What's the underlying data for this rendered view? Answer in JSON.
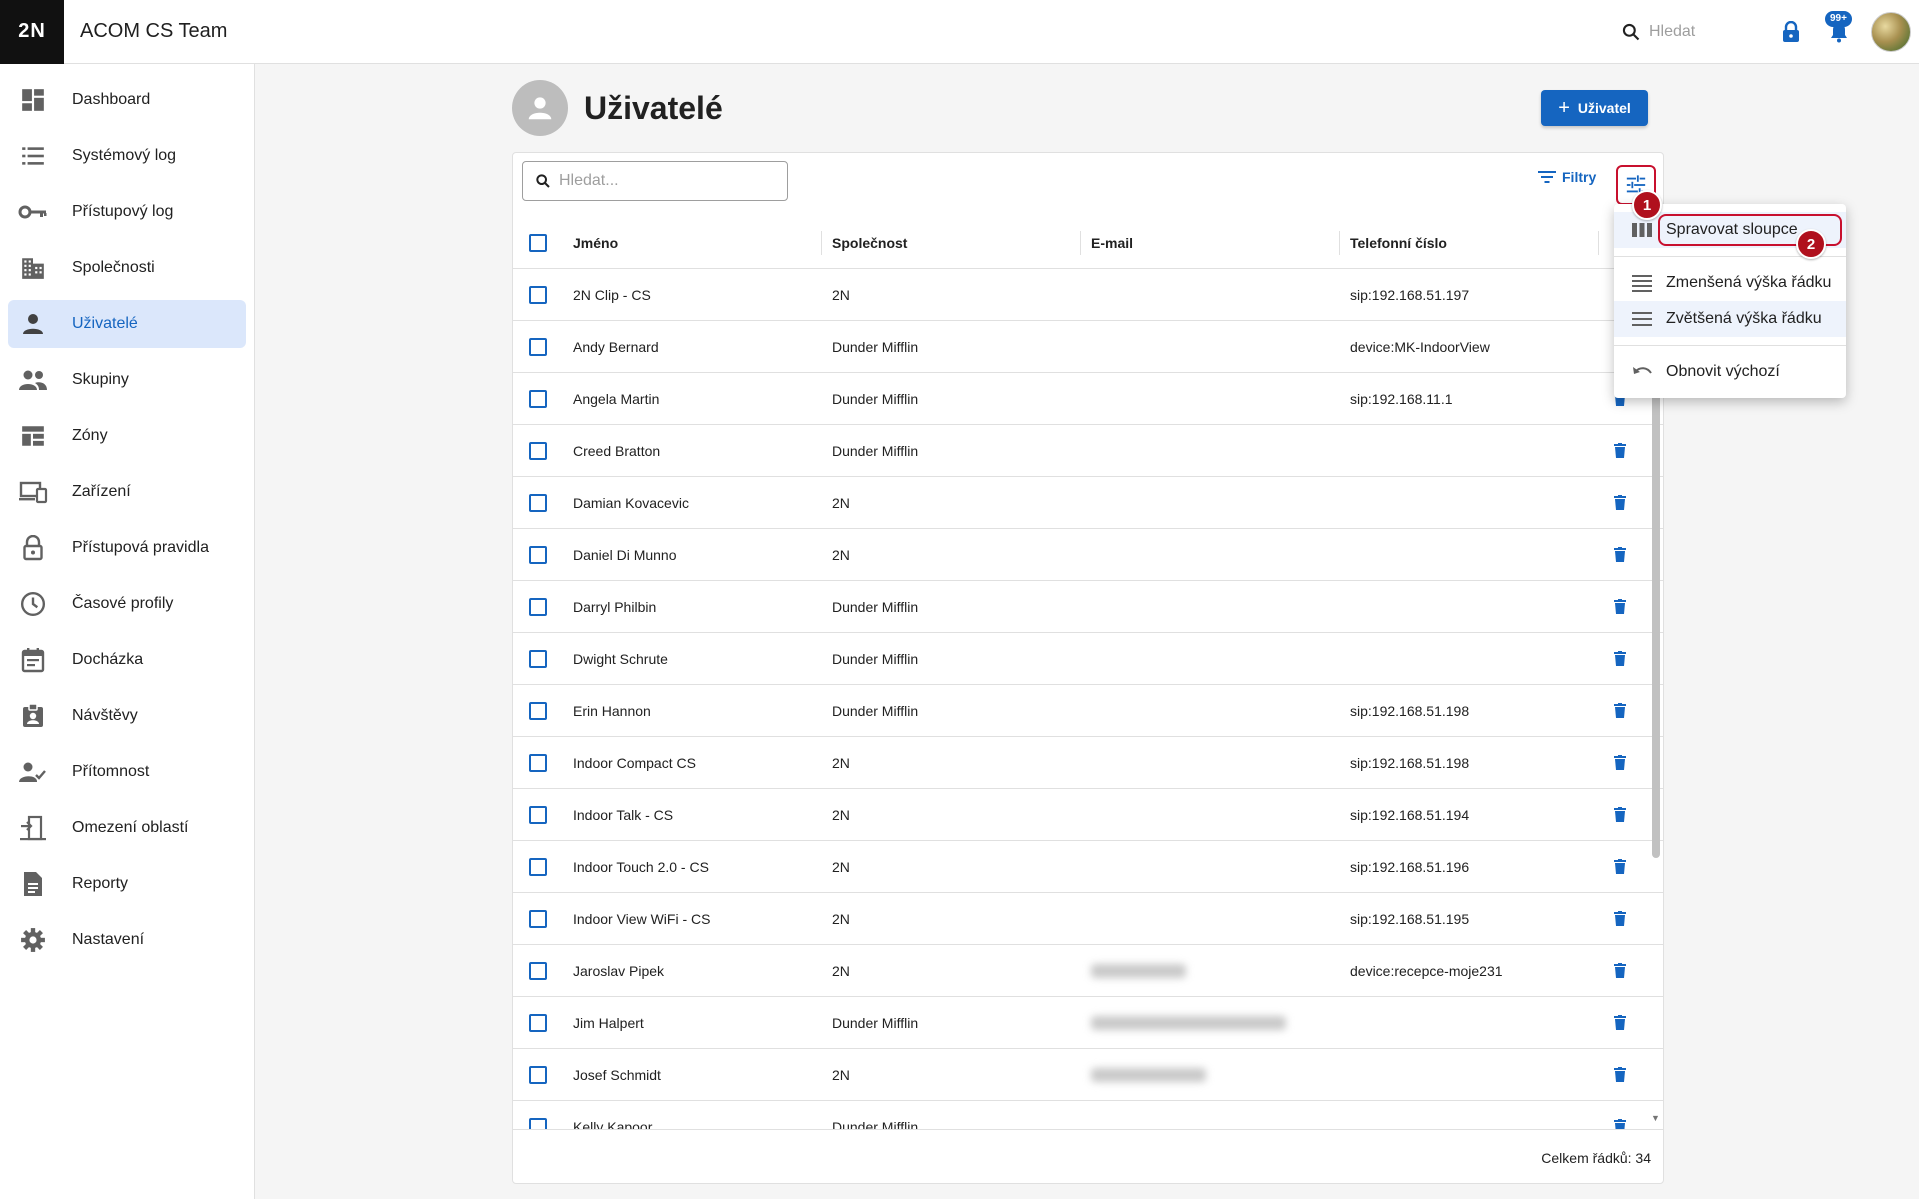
{
  "app": {
    "logo": "2N",
    "title": "ACOM CS Team"
  },
  "topbar": {
    "search_placeholder": "Hledat",
    "notifications_badge": "99+"
  },
  "sidebar": {
    "items": [
      {
        "label": "Dashboard",
        "icon": "dashboard-icon"
      },
      {
        "label": "Systémový log",
        "icon": "list-icon"
      },
      {
        "label": "Přístupový log",
        "icon": "key-icon"
      },
      {
        "label": "Společnosti",
        "icon": "building-icon"
      },
      {
        "label": "Uživatelé",
        "icon": "person-icon",
        "active": true
      },
      {
        "label": "Skupiny",
        "icon": "group-icon"
      },
      {
        "label": "Zóny",
        "icon": "zones-icon"
      },
      {
        "label": "Zařízení",
        "icon": "devices-icon"
      },
      {
        "label": "Přístupová pravidla",
        "icon": "lock-icon"
      },
      {
        "label": "Časové profily",
        "icon": "clock-icon"
      },
      {
        "label": "Docházka",
        "icon": "calendar-icon"
      },
      {
        "label": "Návštěvy",
        "icon": "badge-icon"
      },
      {
        "label": "Přítomnost",
        "icon": "person-check-icon"
      },
      {
        "label": "Omezení oblastí",
        "icon": "door-icon"
      },
      {
        "label": "Reporty",
        "icon": "document-icon"
      },
      {
        "label": "Nastavení",
        "icon": "gear-icon"
      }
    ]
  },
  "page": {
    "title": "Uživatelé",
    "add_button_label": "Uživatel"
  },
  "table": {
    "search_placeholder": "Hledat...",
    "filters_label": "Filtry",
    "columns": [
      "Jméno",
      "Společnost",
      "E-mail",
      "Telefonní číslo"
    ],
    "rows": [
      {
        "name": "2N Clip - CS",
        "company": "2N",
        "email_blurred": false,
        "phone": "sip:192.168.51.197",
        "trash": false
      },
      {
        "name": "Andy Bernard",
        "company": "Dunder Mifflin",
        "email_blurred": false,
        "phone": "device:MK-IndoorView",
        "trash": false
      },
      {
        "name": "Angela Martin",
        "company": "Dunder Mifflin",
        "email_blurred": false,
        "phone": "sip:192.168.11.1",
        "trash": true
      },
      {
        "name": "Creed Bratton",
        "company": "Dunder Mifflin",
        "email_blurred": false,
        "phone": "",
        "trash": true
      },
      {
        "name": "Damian Kovacevic",
        "company": "2N",
        "email_blurred": false,
        "phone": "",
        "trash": true
      },
      {
        "name": "Daniel Di Munno",
        "company": "2N",
        "email_blurred": false,
        "phone": "",
        "trash": true
      },
      {
        "name": "Darryl Philbin",
        "company": "Dunder Mifflin",
        "email_blurred": false,
        "phone": "",
        "trash": true
      },
      {
        "name": "Dwight Schrute",
        "company": "Dunder Mifflin",
        "email_blurred": false,
        "phone": "",
        "trash": true
      },
      {
        "name": "Erin Hannon",
        "company": "Dunder Mifflin",
        "email_blurred": false,
        "phone": "sip:192.168.51.198",
        "trash": true
      },
      {
        "name": "Indoor Compact CS",
        "company": "2N",
        "email_blurred": false,
        "phone": "sip:192.168.51.198",
        "trash": true
      },
      {
        "name": "Indoor Talk - CS",
        "company": "2N",
        "email_blurred": false,
        "phone": "sip:192.168.51.194",
        "trash": true
      },
      {
        "name": "Indoor Touch 2.0 - CS",
        "company": "2N",
        "email_blurred": false,
        "phone": "sip:192.168.51.196",
        "trash": true
      },
      {
        "name": "Indoor View WiFi - CS",
        "company": "2N",
        "email_blurred": false,
        "phone": "sip:192.168.51.195",
        "trash": true
      },
      {
        "name": "Jaroslav Pipek",
        "company": "2N",
        "email_blurred": true,
        "phone": "device:recepce-moje231",
        "trash": true
      },
      {
        "name": "Jim Halpert",
        "company": "Dunder Mifflin",
        "email_blurred": true,
        "phone": "",
        "trash": true
      },
      {
        "name": "Josef Schmidt",
        "company": "2N",
        "email_blurred": true,
        "phone": "",
        "trash": true
      },
      {
        "name": "Kelly Kapoor",
        "company": "Dunder Mifflin",
        "email_blurred": false,
        "phone": "",
        "trash": true
      }
    ],
    "footer": "Celkem řádků: 34"
  },
  "menu": {
    "items": [
      {
        "label": "Spravovat sloupce",
        "icon": "columns-icon"
      },
      {
        "label": "Zmenšená výška řádku",
        "icon": "density-compact-icon"
      },
      {
        "label": "Zvětšená výška řádku",
        "icon": "density-comfortable-icon"
      },
      {
        "label": "Obnovit výchozí",
        "icon": "undo-icon"
      }
    ]
  },
  "annotations": {
    "step1": "1",
    "step2": "2"
  },
  "colors": {
    "accent": "#1565c0",
    "highlight": "#c8102e",
    "step_badge": "#b0101d"
  }
}
